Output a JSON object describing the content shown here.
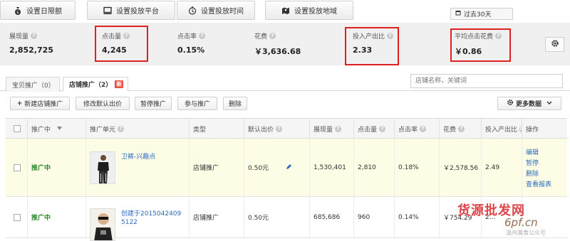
{
  "colors": {
    "highlight": "#e02020",
    "status_green": "#2a8a2a",
    "link_blue": "#2b6cc4",
    "new_badge": "#e84c3d",
    "row_highlight": "#fdfce5"
  },
  "toolbar": {
    "buttons": [
      {
        "label": "设置日限额",
        "icon": "money-bag-icon"
      },
      {
        "label": "设置投放平台",
        "icon": "monitor-icon"
      },
      {
        "label": "设置投放时间",
        "icon": "clock-icon"
      },
      {
        "label": "设置投放地域",
        "icon": "map-pin-icon"
      }
    ],
    "date_range": "过去30天"
  },
  "metrics": [
    {
      "label": "展现量",
      "value": "2,852,725"
    },
    {
      "label": "点击量",
      "value": "4,245"
    },
    {
      "label": "点击率",
      "value": "0.15%"
    },
    {
      "label": "花费",
      "value": "￥3,636.68"
    },
    {
      "label": "投入产出比",
      "value": "2.33"
    },
    {
      "label": "平均点击花费",
      "value": "￥0.86"
    }
  ],
  "tabs": [
    {
      "label": "宝贝推广（0）"
    },
    {
      "label": "店铺推广（2）",
      "badge": "新"
    }
  ],
  "search": {
    "placeholder": "店铺名称，关键词"
  },
  "actions": {
    "new_label": "新建店铺推广",
    "edit_bid_label": "修改默认出价",
    "pause_label": "暂停推广",
    "join_label": "参与推广",
    "delete_label": "删除",
    "more_data_label": "更多数据"
  },
  "table": {
    "headers": {
      "status": "推广中",
      "unit": "推广单元",
      "type": "类型",
      "bid": "默认出价",
      "impressions": "展现量",
      "clicks": "点击量",
      "ctr": "点击率",
      "cost": "花费",
      "roi": "投入产出比",
      "ops": "操作"
    },
    "rows": [
      {
        "status": "推广中",
        "unit": "卫裤-兴趣点",
        "type": "店铺推广",
        "bid": "0.50元",
        "impressions": "1,530,401",
        "clicks": "2,810",
        "ctr": "0.18%",
        "cost": "￥2,578.56",
        "roi": "2.49",
        "ops": [
          "编辑",
          "暂停",
          "删除",
          "查看报表"
        ]
      },
      {
        "status": "推广中",
        "unit_line1": "创建于2015042409",
        "unit_line2": "5122",
        "type": "店铺推广",
        "bid": "0.50元",
        "impressions": "685,686",
        "clicks": "960",
        "ctr": "0.14%",
        "cost": "￥754.29",
        "roi": "2..."
      }
    ]
  },
  "watermark": {
    "cn": "货源批发网",
    "en": "6pf.cn",
    "sub": "温州美食公众号"
  }
}
